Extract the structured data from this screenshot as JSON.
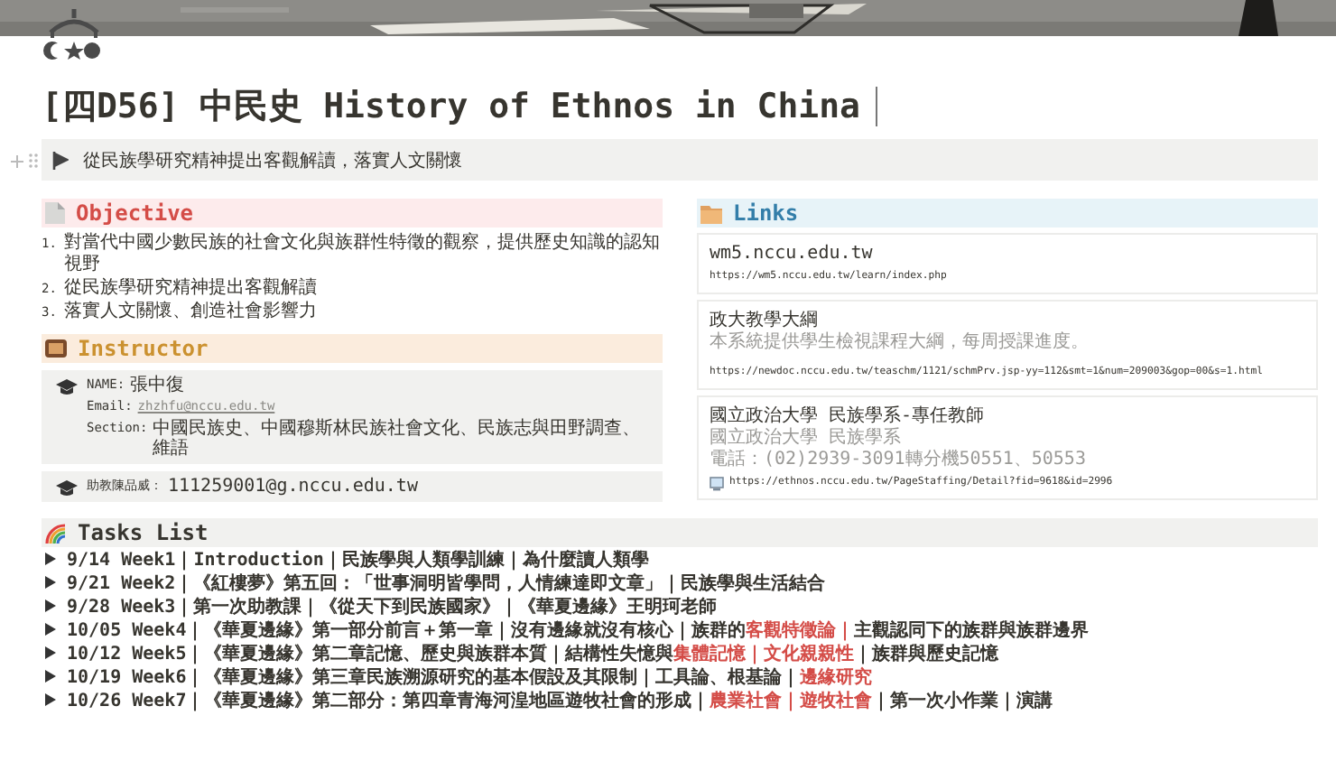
{
  "title": "[四D56] 中民史 History of Ethnos in China",
  "callout": {
    "text": "從民族學研究精神提出客觀解讀，落實人文關懷"
  },
  "objective": {
    "heading": "Objective",
    "items": [
      {
        "number": "1.",
        "text": "對當代中國少數民族的社會文化與族群性特徵的觀察，提供歷史知識的認知視野"
      },
      {
        "number": "2.",
        "text": "從民族學研究精神提出客觀解讀"
      },
      {
        "number": "3.",
        "text": "落實人文關懷、創造社會影響力"
      }
    ]
  },
  "instructor": {
    "heading": "Instructor",
    "cards": [
      {
        "lines": [
          {
            "kind": "text",
            "label": "NAME:",
            "text": "張中復"
          },
          {
            "kind": "link",
            "label": "Email:",
            "text": "zhzhfu@nccu.edu.tw"
          },
          {
            "kind": "text",
            "label": "Section:",
            "text": "中國民族史、中國穆斯林民族社會文化、民族志與田野調查、維語"
          }
        ]
      },
      {
        "lines": [
          {
            "kind": "text",
            "label": "助教陳品威：",
            "text": "111259001@g.nccu.edu.tw"
          }
        ]
      }
    ]
  },
  "links": {
    "heading": "Links",
    "cards": [
      {
        "title": "wm5.nccu.edu.tw",
        "url": "https://wm5.nccu.edu.tw/learn/index.php",
        "favicon": false
      },
      {
        "title": "政大教學大綱",
        "description": "本系統提供學生檢視課程大綱，每周授課進度。",
        "url": "https://newdoc.nccu.edu.tw/teaschm/1121/schmPrv.jsp-yy=112&smt=1&num=209003&gop=00&s=1.html",
        "favicon": false
      },
      {
        "title": "國立政治大學 民族學系-專任教師",
        "description": "國立政治大學 民族學系",
        "detail": "電話：(02)2939-3091轉分機50551、50553",
        "url": "https://ethnos.nccu.edu.tw/PageStaffing/Detail?fid=9618&id=2996",
        "favicon": true
      }
    ]
  },
  "tasks": {
    "heading": "Tasks List",
    "items": [
      {
        "expanded": false,
        "segments": [
          {
            "kind": "plain",
            "text": "9/14 Week1｜Introduction｜民族學與人類學訓練｜為什麼讀人類學"
          }
        ]
      },
      {
        "expanded": false,
        "segments": [
          {
            "kind": "plain",
            "text": "9/21 Week2｜《紅樓夢》第五回：「世事洞明皆學問，人情練達即文章」｜民族學與生活結合"
          }
        ]
      },
      {
        "expanded": false,
        "segments": [
          {
            "kind": "plain",
            "text": "9/28 Week3｜第一次助教課｜《從天下到民族國家》｜《華夏邊緣》王明珂老師"
          }
        ]
      },
      {
        "expanded": false,
        "segments": [
          {
            "kind": "plain",
            "text": "10/05 Week4｜《華夏邊緣》第一部分前言＋第一章｜沒有邊緣就沒有核心｜族群的"
          },
          {
            "kind": "highlight",
            "text": "客觀特徵論｜"
          },
          {
            "kind": "plain",
            "text": "主觀認同下的族群與族群邊界"
          }
        ]
      },
      {
        "expanded": false,
        "segments": [
          {
            "kind": "plain",
            "text": "10/12 Week5｜《華夏邊緣》第二章記憶、歷史與族群本質｜結構性失憶與"
          },
          {
            "kind": "highlight",
            "text": "集體記憶｜文化親親性"
          },
          {
            "kind": "plain",
            "text": "｜族群與歷史記憶"
          }
        ]
      },
      {
        "expanded": false,
        "segments": [
          {
            "kind": "plain",
            "text": "10/19 Week6｜《華夏邊緣》第三章民族溯源研究的基本假設及其限制｜工具論、根基論｜"
          },
          {
            "kind": "highlight",
            "text": "邊緣研究"
          }
        ]
      },
      {
        "expanded": false,
        "segments": [
          {
            "kind": "plain",
            "text": "10/26 Week7｜《華夏邊緣》第二部分：第四章青海河湟地區遊牧社會的形成｜"
          },
          {
            "kind": "highlight",
            "text": "農業社會｜遊牧社會"
          },
          {
            "kind": "plain",
            "text": "｜第一次小作業｜演講"
          }
        ]
      }
    ]
  }
}
